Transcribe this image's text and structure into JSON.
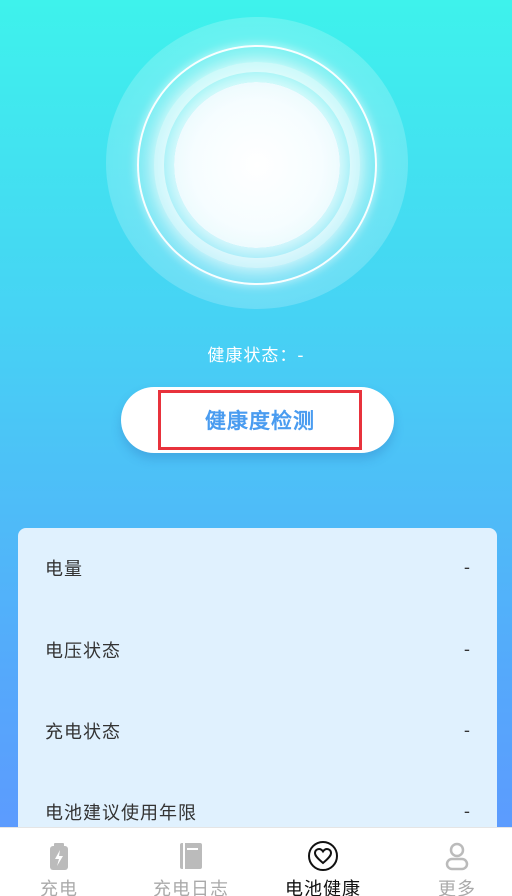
{
  "health": {
    "status_label": "健康状态：",
    "status_value": "-",
    "detect_button": "健康度检测"
  },
  "info": {
    "rows": [
      {
        "label": "电量",
        "value": "-"
      },
      {
        "label": "电压状态",
        "value": "-"
      },
      {
        "label": "充电状态",
        "value": "-"
      },
      {
        "label": "电池建议使用年限",
        "value": "-"
      }
    ]
  },
  "tabs": [
    {
      "label": "充电",
      "icon": "battery-icon",
      "active": false
    },
    {
      "label": "充电日志",
      "icon": "book-icon",
      "active": false
    },
    {
      "label": "电池健康",
      "icon": "heart-icon",
      "active": true
    },
    {
      "label": "更多",
      "icon": "person-icon",
      "active": false
    }
  ],
  "colors": {
    "accent": "#4A9CF0",
    "highlight_border": "#E8323C",
    "card_background": "#E0F1FE",
    "tab_inactive": "#AAAAAA",
    "tab_active": "#111111"
  }
}
